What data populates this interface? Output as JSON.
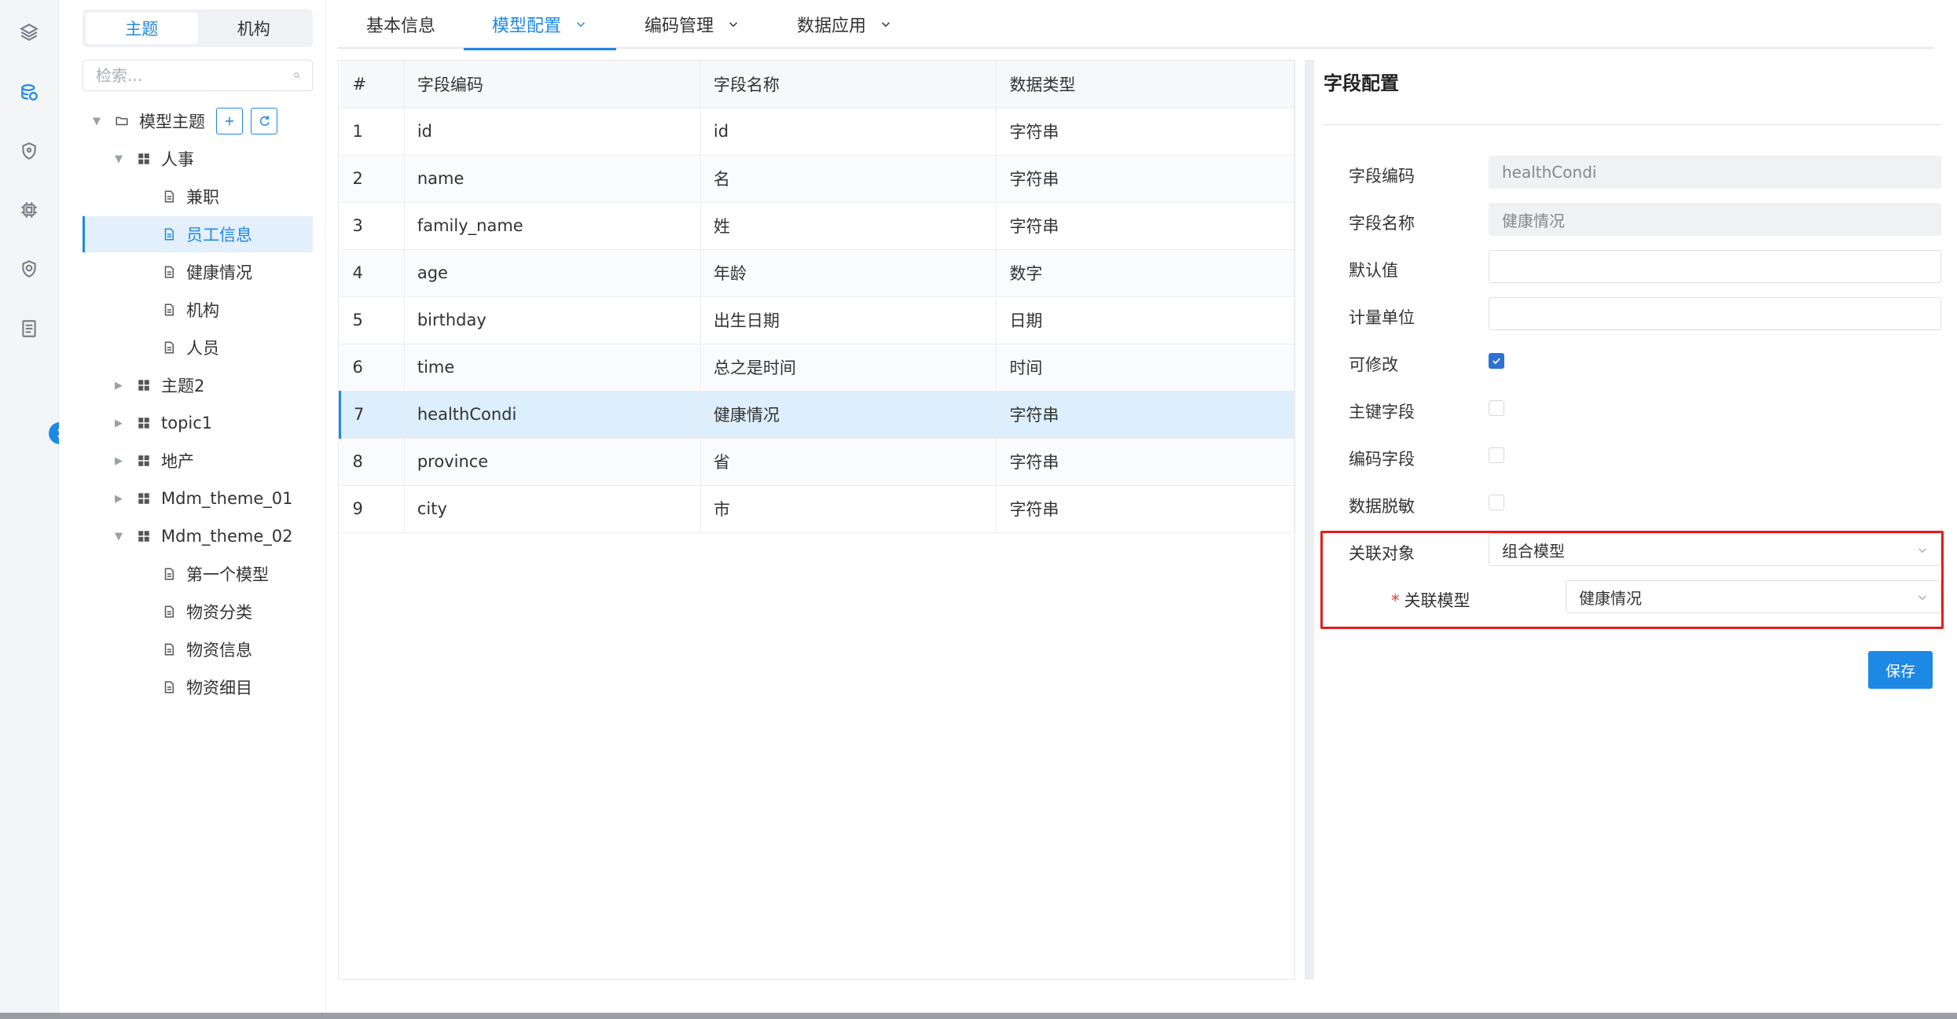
{
  "rail": {
    "icons": [
      "layers-icon",
      "database-icon",
      "shield-icon",
      "chip-icon",
      "security-icon",
      "document-icon"
    ]
  },
  "tree": {
    "segments": [
      {
        "label": "主题",
        "active": true
      },
      {
        "label": "机构",
        "active": false
      }
    ],
    "search_placeholder": "检索...",
    "root": {
      "label": "模型主题"
    },
    "nodes": [
      {
        "label": "人事",
        "type": "group",
        "expanded": true
      },
      {
        "label": "兼职",
        "type": "doc"
      },
      {
        "label": "员工信息",
        "type": "doc",
        "selected": true
      },
      {
        "label": "健康情况",
        "type": "doc"
      },
      {
        "label": "机构",
        "type": "doc"
      },
      {
        "label": "人员",
        "type": "doc"
      },
      {
        "label": "主题2",
        "type": "group",
        "expanded": false
      },
      {
        "label": "topic1",
        "type": "group",
        "expanded": false
      },
      {
        "label": "地产",
        "type": "group",
        "expanded": false
      },
      {
        "label": "Mdm_theme_01",
        "type": "group",
        "expanded": false
      },
      {
        "label": "Mdm_theme_02",
        "type": "group",
        "expanded": true
      },
      {
        "label": "第一个模型",
        "type": "doc"
      },
      {
        "label": "物资分类",
        "type": "doc"
      },
      {
        "label": "物资信息",
        "type": "doc"
      },
      {
        "label": "物资细目",
        "type": "doc"
      }
    ]
  },
  "tabs": [
    {
      "label": "基本信息",
      "dropdown": false,
      "active": false
    },
    {
      "label": "模型配置",
      "dropdown": true,
      "active": true
    },
    {
      "label": "编码管理",
      "dropdown": true,
      "active": false
    },
    {
      "label": "数据应用",
      "dropdown": true,
      "active": false
    }
  ],
  "table": {
    "headers": [
      "#",
      "字段编码",
      "字段名称",
      "数据类型"
    ],
    "rows": [
      [
        "1",
        "id",
        "id",
        "字符串"
      ],
      [
        "2",
        "name",
        "名",
        "字符串"
      ],
      [
        "3",
        "family_name",
        "姓",
        "字符串"
      ],
      [
        "4",
        "age",
        "年龄",
        "数字"
      ],
      [
        "5",
        "birthday",
        "出生日期",
        "日期"
      ],
      [
        "6",
        "time",
        "总之是时间",
        "时间"
      ],
      [
        "7",
        "healthCondi",
        "健康情况",
        "字符串"
      ],
      [
        "8",
        "province",
        "省",
        "字符串"
      ],
      [
        "9",
        "city",
        "市",
        "字符串"
      ]
    ],
    "selected_row": 7
  },
  "form": {
    "title": "字段配置",
    "field_code_label": "字段编码",
    "field_code_value": "healthCondi",
    "field_name_label": "字段名称",
    "field_name_value": "健康情况",
    "default_label": "默认值",
    "default_value": "",
    "unit_label": "计量单位",
    "unit_value": "",
    "editable_label": "可修改",
    "editable_checked": true,
    "primary_key_label": "主键字段",
    "primary_key_checked": false,
    "code_field_label": "编码字段",
    "code_field_checked": false,
    "mask_label": "数据脱敏",
    "mask_checked": false,
    "relation_label": "关联对象",
    "relation_value": "组合模型",
    "related_model_required": "*",
    "related_model_label": "关联模型",
    "related_model_value": "健康情况",
    "save_label": "保存"
  },
  "colors": {
    "accent": "#1e88e5",
    "highlight": "#e21d1d"
  }
}
